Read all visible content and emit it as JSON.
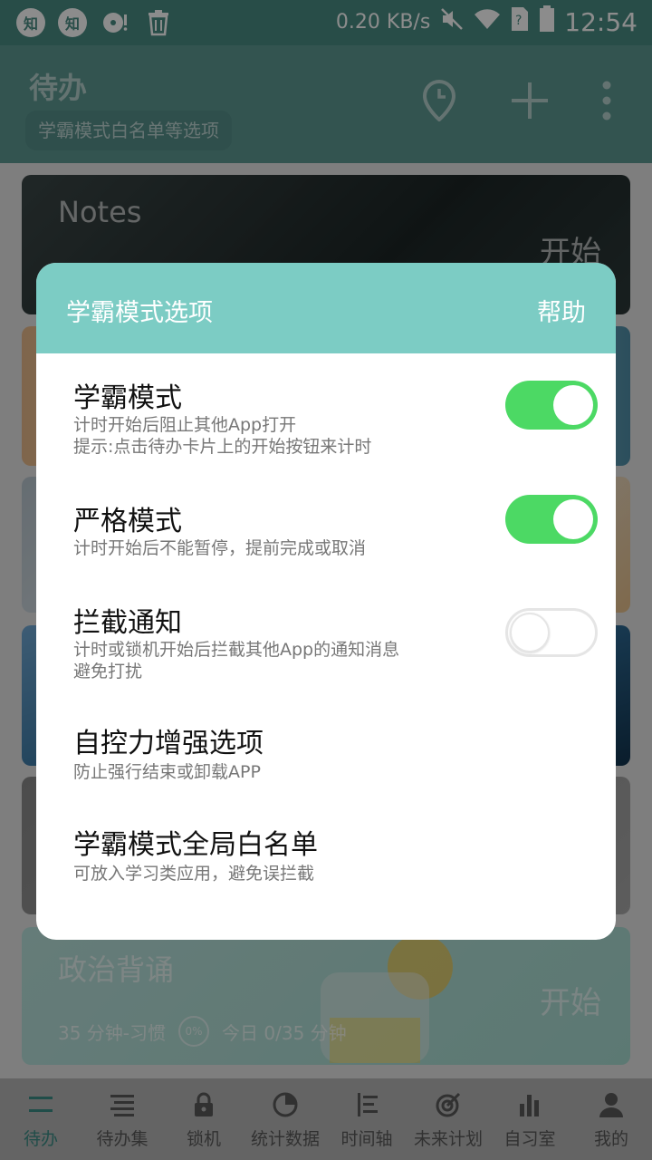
{
  "status_bar": {
    "left_icons": [
      "zhihu-icon",
      "zhihu-icon",
      "vinyl-icon",
      "trash-icon"
    ],
    "zhihu_glyph": "知",
    "speed": "0.20 KB/s",
    "time": "12:54"
  },
  "app_bar": {
    "title": "待办",
    "chip": "学霸模式白名单等选项"
  },
  "cards": {
    "notes": {
      "title": "Notes",
      "start": "开始"
    },
    "politics": {
      "title": "政治背诵",
      "start": "开始",
      "duration": "35 分钟-习惯",
      "percent": "0%",
      "today": "今日 0/35 分钟"
    }
  },
  "dialog": {
    "title": "学霸模式选项",
    "help": "帮助",
    "options": [
      {
        "title": "学霸模式",
        "desc_line1": "计时开始后阻止其他App打开",
        "desc_line2": "提示:点击待办卡片上的开始按钮来计时",
        "toggle": "on"
      },
      {
        "title": "严格模式",
        "desc_line1": "计时开始后不能暂停，提前完成或取消",
        "toggle": "on"
      },
      {
        "title": "拦截通知",
        "desc_line1": "计时或锁机开始后拦截其他App的通知消息",
        "desc_line2": "避免打扰",
        "toggle": "off"
      },
      {
        "title": "自控力增强选项",
        "desc_line1": "防止强行结束或卸载APP"
      },
      {
        "title": "学霸模式全局白名单",
        "desc_line1": "可放入学习类应用，避免误拦截"
      }
    ]
  },
  "bottom_nav": [
    {
      "label": "待办",
      "icon": "todo-list-icon",
      "active": true
    },
    {
      "label": "待办集",
      "icon": "todo-set-icon"
    },
    {
      "label": "锁机",
      "icon": "lock-icon"
    },
    {
      "label": "统计数据",
      "icon": "pie-chart-icon"
    },
    {
      "label": "时间轴",
      "icon": "timeline-icon"
    },
    {
      "label": "未来计划",
      "icon": "target-icon"
    },
    {
      "label": "自习室",
      "icon": "bar-chart-icon"
    },
    {
      "label": "我的",
      "icon": "person-icon"
    }
  ],
  "colors": {
    "accent": "#7cccc4",
    "toggle_on": "#4cd964",
    "nav_active": "#3b8c86"
  }
}
